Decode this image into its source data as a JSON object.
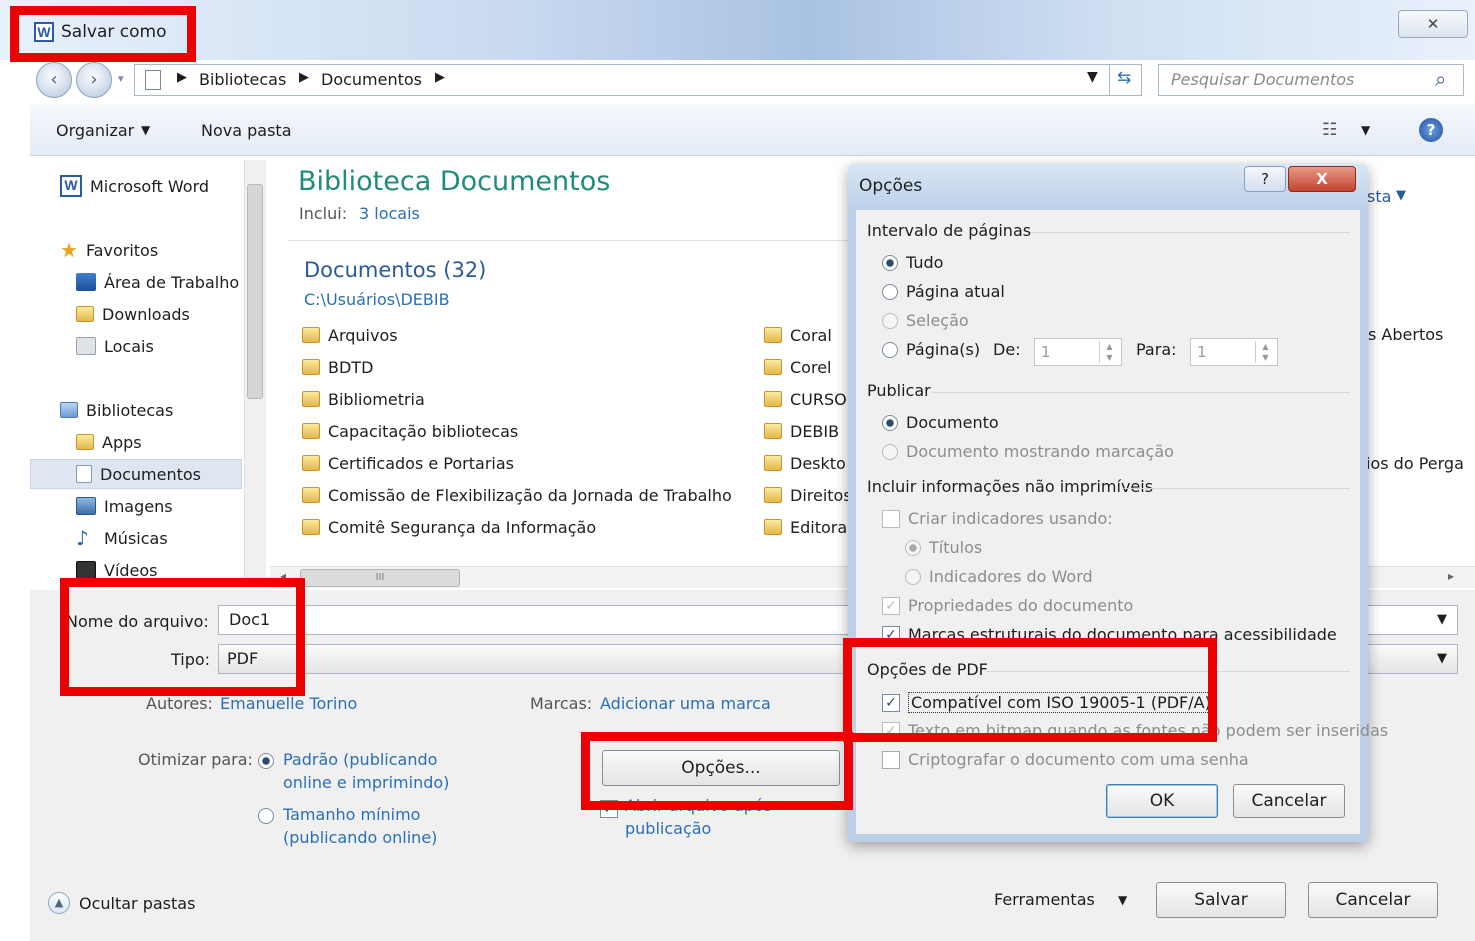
{
  "window": {
    "title": "Salvar como",
    "close_symbol": "✕"
  },
  "address": {
    "crumbs": [
      "Bibliotecas",
      "Documentos"
    ],
    "search_placeholder": "Pesquisar Documentos"
  },
  "toolbar": {
    "organize": "Organizar",
    "new_folder": "Nova pasta"
  },
  "sidebar": {
    "app": "Microsoft Word",
    "favorites": "Favoritos",
    "fav_items": [
      "Área de Trabalho",
      "Downloads",
      "Locais"
    ],
    "libraries": "Bibliotecas",
    "lib_items": [
      "Apps",
      "Documentos",
      "Imagens",
      "Músicas",
      "Vídeos"
    ]
  },
  "main": {
    "title": "Biblioteca Documentos",
    "includes_label": "Inclui:",
    "includes_link": "3 locais",
    "group_title": "Documentos (32)",
    "path": "C:\\Usuários\\DEBIB",
    "col1": [
      "Arquivos",
      "BDTD",
      "Bibliometria",
      "Capacitação bibliotecas",
      "Certificados e Portarias",
      "Comissão de Flexibilização da Jornada de Trabalho",
      "Comitê Segurança da Informação"
    ],
    "col2": [
      "Coral",
      "Corel",
      "CURSO",
      "DEBIB",
      "Deskto",
      "Direitos",
      "Editora"
    ],
    "right_fragments": [
      "sta",
      "s Abertos",
      "ios do Perga"
    ],
    "hscroll": "III"
  },
  "form": {
    "filename_label": "Nome do arquivo:",
    "filename_value": "Doc1",
    "type_label": "Tipo:",
    "type_value": "PDF",
    "authors_label": "Autores:",
    "authors_value": "Emanuelle Torino",
    "tags_label": "Marcas:",
    "tags_value": "Adicionar uma marca",
    "optimize_label": "Otimizar para:",
    "optimize_opt1a": "Padrão (publicando",
    "optimize_opt1b": "online e imprimindo)",
    "optimize_opt2a": "Tamanho mínimo",
    "optimize_opt2b": "(publicando online)",
    "options_button": "Opções...",
    "open_after_a": "Abrir arquivo após",
    "open_after_b": "publicação",
    "hide_folders": "Ocultar pastas",
    "tools": "Ferramentas",
    "save": "Salvar",
    "cancel": "Cancelar"
  },
  "dialog": {
    "title": "Opções",
    "help": "?",
    "close": "X",
    "range_section": "Intervalo de páginas",
    "range_all": "Tudo",
    "range_current": "Página atual",
    "range_selection": "Seleção",
    "range_pages": "Página(s)",
    "from_label": "De:",
    "from_value": "1",
    "to_label": "Para:",
    "to_value": "1",
    "publish_section": "Publicar",
    "publish_doc": "Documento",
    "publish_markup": "Documento mostrando marcação",
    "nonprint_section": "Incluir informações não imprimíveis",
    "create_bookmarks": "Criar indicadores usando:",
    "bookmarks_titles": "Títulos",
    "bookmarks_word": "Indicadores do Word",
    "doc_properties": "Propriedades do documento",
    "struct_tags": "Marcas estruturais do documento para acessibilidade",
    "pdf_section": "Opções de PDF",
    "iso": "Compatível com ISO 19005-1 (PDF/A)",
    "bitmap_text": "Texto em bitmap quando as fontes não podem ser inseridas",
    "encrypt": "Criptografar o documento com uma senha",
    "ok": "OK",
    "cancel": "Cancelar"
  },
  "colors": {
    "highlight": "#ee0000",
    "link": "#2a6fb9",
    "title_green": "#1f8c7a"
  }
}
